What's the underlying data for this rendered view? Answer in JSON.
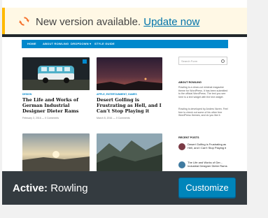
{
  "notice": {
    "text": "New version available.",
    "link": "Update now"
  },
  "preview": {
    "nav": [
      "HOME",
      "ABOUT ROWLING",
      "DROPDOWN ▾",
      "STYLE GUIDE"
    ],
    "posts": [
      {
        "category": "DESIGN",
        "title": "The Life and Works of German Industrial Designer Dieter Rams",
        "meta": "February 3, 2016 — 0 Comments"
      },
      {
        "category": "APPLE, ENTERTAINMENT, GAMES",
        "title": "Desert Golfing is Frustrating as Hell, and I Can’t Stop Playing it",
        "meta": "March 8, 2016 — 0 Comments"
      }
    ],
    "sidebar": {
      "search_placeholder": "Search Form",
      "about_title": "ABOUT ROWLING",
      "about_text_1": "Rowling is a clean-cut minimal magazine theme for WordPress. It has been submitted to the official WordPress. The text you see here is a text widget with the text widget.",
      "about_text_2": "Rowling is developed by Anders Norén. Feel free to check out some of his other free WordPress themes, and do you like it.",
      "recent_title": "RECENT POSTS",
      "recent": [
        "Desert Golfing is Frustrating as Hell, and I Can’t Stop Playing it",
        "The Life and Works of Ger... Industrial Designer Dieter Rams"
      ]
    }
  },
  "footer": {
    "active_label": "Active:",
    "theme_name": "Rowling",
    "customize_label": "Customize"
  },
  "colors": {
    "notice_border": "#ffb900",
    "link": "#0073aa",
    "primary_button": "#0085ba",
    "footer_bg": "#2c3338",
    "nav": "#0088cc"
  },
  "icons": {
    "update": "update-icon"
  }
}
